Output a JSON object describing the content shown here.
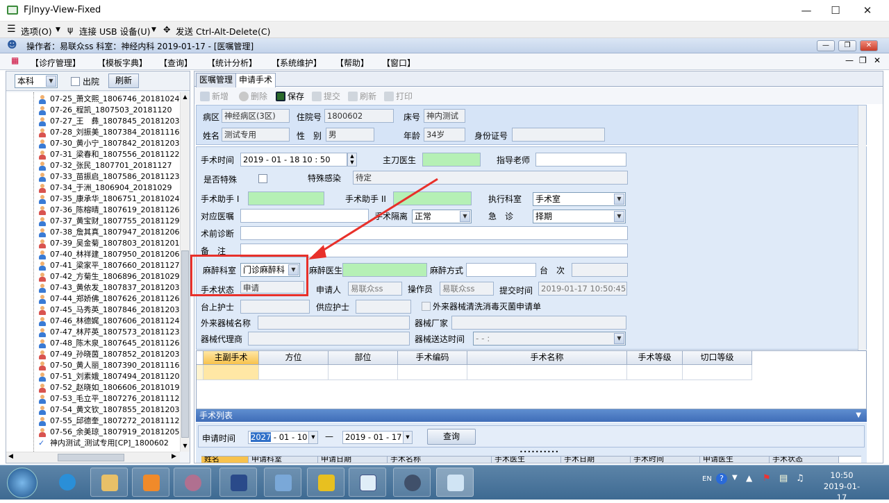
{
  "viewer": {
    "title": "Fjlnyy-View-Fixed",
    "menu": {
      "options": "选项(O)",
      "usb": "连接 USB 设备(U)",
      "send_cad": "发送 Ctrl-Alt-Delete(C)"
    }
  },
  "app": {
    "title": "操作者：易联众ss  科室：神经内科  2019-01-17 - [医嘱管理]",
    "menu": [
      "【诊疗管理】",
      "【模板字典】",
      "【查询】",
      "【统计分析】",
      "【系统维护】",
      "【帮助】",
      "【窗口】"
    ]
  },
  "left": {
    "dept_value": "本科",
    "discharged_label": "出院",
    "refresh_label": "刷新",
    "patients": [
      {
        "label": "07-25_萧文熙_1806746_20181024",
        "gender": "m"
      },
      {
        "label": "07-26_程凯_1807503_20181120",
        "gender": "m"
      },
      {
        "label": "07-27_王　彝_1807845_20181203",
        "gender": "m"
      },
      {
        "label": "07-28_刘振美_1807384_20181116",
        "gender": "f"
      },
      {
        "label": "07-30_黄小宁_1807842_20181203",
        "gender": "m"
      },
      {
        "label": "07-31_梁春和_1807556_20181122",
        "gender": "f"
      },
      {
        "label": "07-32_张民_1807701_20181127",
        "gender": "m"
      },
      {
        "label": "07-33_苗振启_1807586_20181123",
        "gender": "m"
      },
      {
        "label": "07-34_于洲_1806904_20181029",
        "gender": "f"
      },
      {
        "label": "07-35_康承华_1806751_20181024",
        "gender": "m"
      },
      {
        "label": "07-36_陈榕晴_1807619_20181126",
        "gender": "f"
      },
      {
        "label": "07-37_黄宝财_1807755_20181129",
        "gender": "m"
      },
      {
        "label": "07-38_詹其真_1807947_20181206",
        "gender": "m"
      },
      {
        "label": "07-39_吴金菊_1807803_20181201",
        "gender": "f"
      },
      {
        "label": "07-40_林祥建_1807950_20181206",
        "gender": "m"
      },
      {
        "label": "07-41_梁家平_1807660_20181127",
        "gender": "m"
      },
      {
        "label": "07-42_方菊生_1806896_20181029",
        "gender": "f"
      },
      {
        "label": "07-43_黄依发_1807837_20181203",
        "gender": "m"
      },
      {
        "label": "07-44_郑娇佛_1807626_20181126",
        "gender": "m"
      },
      {
        "label": "07-45_马秀英_1807846_20181203",
        "gender": "f"
      },
      {
        "label": "07-46_林德娓_1807606_20181124",
        "gender": "m"
      },
      {
        "label": "07-47_林芹英_1807573_20181123",
        "gender": "m"
      },
      {
        "label": "07-48_陈木泉_1807645_20181126",
        "gender": "m"
      },
      {
        "label": "07-49_孙晓茵_1807852_20181203",
        "gender": "f"
      },
      {
        "label": "07-50_黄人丽_1807390_20181116",
        "gender": "f"
      },
      {
        "label": "07-51_刘素娥_1807494_20181120",
        "gender": "m"
      },
      {
        "label": "07-52_赵晓如_1806606_20181019",
        "gender": "f"
      },
      {
        "label": "07-53_毛立平_1807276_20181112",
        "gender": "m"
      },
      {
        "label": "07-54_黄文钦_1807855_20181203",
        "gender": "m"
      },
      {
        "label": "07-55_邱德奎_1807272_20181112",
        "gender": "m"
      },
      {
        "label": "07-56_余美琼_1807919_20181205",
        "gender": "f"
      }
    ],
    "selected_patient": "神内测试_测试专用[CP]_1800602"
  },
  "tabs": [
    "医嘱管理",
    "申请手术"
  ],
  "toolbar": {
    "new": "新增",
    "delete": "删除",
    "save": "保存",
    "submit": "提交",
    "refresh": "刷新",
    "print": "打印"
  },
  "patient": {
    "ward_label": "病区",
    "ward": "神经病区(3区)",
    "admission_label": "住院号",
    "admission": "1800602",
    "bed_label": "床号",
    "bed": "神内测试",
    "name_label": "姓名",
    "name": "测试专用",
    "sex_label": "性　别",
    "sex": "男",
    "age_label": "年龄",
    "age": "34岁",
    "id_label": "身份证号",
    "id": ""
  },
  "form": {
    "op_time_label": "手术时间",
    "op_time": "2019 - 01 - 18    10 : 50",
    "surgeon_label": "主刀医生",
    "surgeon": "",
    "mentor_label": "指导老师",
    "mentor": "",
    "special_label": "是否特殊",
    "infect_label": "特殊感染",
    "infect": "待定",
    "asst1_label": "手术助手 I",
    "asst1": "",
    "asst2_label": "手术助手 II",
    "asst2": "",
    "exec_dept_label": "执行科室",
    "exec_dept": "手术室",
    "order_label": "对应医嘱",
    "order": "",
    "isolation_label": "手术隔离",
    "isolation": "正常",
    "urgent_label": "急　诊",
    "urgent": "择期",
    "diagnosis_label": "术前诊断",
    "diagnosis": "",
    "note_label": "备　注",
    "note": "",
    "anes_dept_label": "麻醉科室",
    "anes_dept": "门诊麻醉科",
    "anes_doc_label": "麻醉医生",
    "anes_doc": "",
    "anes_method_label": "麻醉方式",
    "anes_method": "",
    "table_label": "台　次",
    "table": "",
    "status_label": "手术状态",
    "status": "申请",
    "applicant_label": "申请人",
    "applicant": "易联众ss",
    "operator_label": "操作员",
    "operator": "易联众ss",
    "submit_time_label": "提交时间",
    "submit_time": "2019-01-17 10:50:45",
    "nurse_label": "台上护士",
    "nurse": "",
    "supply_label": "供应护士",
    "supply": "",
    "sterilize_label": "外来器械清洗消毒灭菌申请单",
    "device_name_label": "外来器械名称",
    "device_name": "",
    "maker_label": "器械厂家",
    "maker": "",
    "agent_label": "器械代理商",
    "agent": "",
    "delivery_label": "器械送达时间",
    "delivery": "-   -        :"
  },
  "grid_headers": [
    "主副手术",
    "方位",
    "部位",
    "手术编码",
    "手术名称",
    "手术等级",
    "切口等级"
  ],
  "list": {
    "title": "手术列表",
    "apply_time_label": "申请时间",
    "from_year": "2027",
    "from_rest": " - 01 - 10",
    "dash": "—",
    "to_date": "2019 - 01 - 17",
    "query_label": "查询",
    "headers": [
      "姓名",
      "申请科室",
      "申请日期",
      "手术名称",
      "手术医生",
      "手术日期",
      "手术时间",
      "申请医生",
      "手术状态"
    ]
  },
  "taskbar": {
    "lang": "EN",
    "time": "10:50",
    "date": "2019-01-17"
  }
}
